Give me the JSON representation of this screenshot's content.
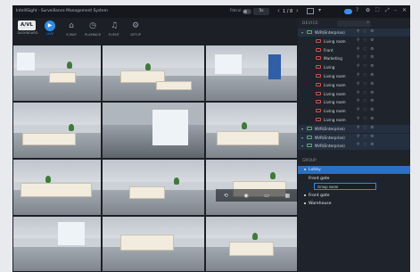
{
  "window": {
    "title": "IntelliSight - Surveillance Management System"
  },
  "topbar": {
    "patrol_label": "Patrol",
    "interval_value": "5s",
    "page_indicator": "1 / 8"
  },
  "nav": {
    "logo_text": "A/VL",
    "items": [
      {
        "label": "DASHBOARD",
        "icon": "dashboard-icon"
      },
      {
        "label": "LIVE",
        "icon": "live-icon",
        "active": true
      },
      {
        "label": "E-MAP",
        "icon": "emap-icon"
      },
      {
        "label": "PLAYBACK",
        "icon": "playback-icon"
      },
      {
        "label": "EVENT",
        "icon": "event-bell-icon"
      },
      {
        "label": "SETUP",
        "icon": "gear-icon"
      }
    ]
  },
  "panel": {
    "device_title": "DEVICE",
    "devices": [
      {
        "name": "NVR(Enterprise)",
        "kind": "nvr",
        "level": 0
      },
      {
        "name": "Living room",
        "kind": "cam",
        "level": 1
      },
      {
        "name": "Front",
        "kind": "cam",
        "level": 1
      },
      {
        "name": "Marketing",
        "kind": "cam",
        "level": 1
      },
      {
        "name": "Living",
        "kind": "cam",
        "level": 1
      },
      {
        "name": "Living room",
        "kind": "cam",
        "level": 1
      },
      {
        "name": "Living room",
        "kind": "cam",
        "level": 1
      },
      {
        "name": "Living room",
        "kind": "cam",
        "level": 1
      },
      {
        "name": "Living room",
        "kind": "cam",
        "level": 1
      },
      {
        "name": "Living room",
        "kind": "cam",
        "level": 1
      },
      {
        "name": "Living room",
        "kind": "cam",
        "level": 1
      },
      {
        "name": "NVR(Enterprise)",
        "kind": "nvr",
        "level": 0
      },
      {
        "name": "NVR(Enterprise)",
        "kind": "nvr",
        "level": 0
      },
      {
        "name": "NVR(Enterprise)",
        "kind": "nvr",
        "level": 0
      }
    ],
    "group_title": "GROUP",
    "groups": [
      {
        "name": "Lobby",
        "selected": true
      },
      {
        "name": "Front gate",
        "selected": false
      },
      {
        "name": "Front gate",
        "selected": false
      },
      {
        "name": "Warehouse",
        "selected": false
      }
    ],
    "group_name_input": "Group name"
  }
}
